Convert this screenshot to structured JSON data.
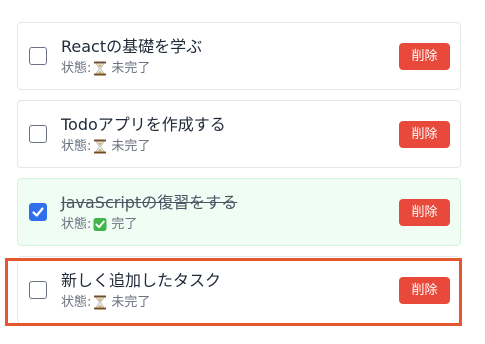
{
  "todos": [
    {
      "title": "Reactの基礎を学ぶ",
      "status_prefix": "状態:",
      "status_icon": "hourglass-icon",
      "status_text": "未完了",
      "completed": false,
      "delete_label": "削除"
    },
    {
      "title": "Todoアプリを作成する",
      "status_prefix": "状態:",
      "status_icon": "hourglass-icon",
      "status_text": "未完了",
      "completed": false,
      "delete_label": "削除"
    },
    {
      "title": "JavaScriptの復習をする",
      "status_prefix": "状態:",
      "status_icon": "green-check-icon",
      "status_text": "完了",
      "completed": true,
      "delete_label": "削除"
    },
    {
      "title": "新しく追加したタスク",
      "status_prefix": "状態:",
      "status_icon": "hourglass-icon",
      "status_text": "未完了",
      "completed": false,
      "delete_label": "削除"
    }
  ],
  "colors": {
    "delete_button": "#e8493b",
    "checkbox_checked": "#2f6fed",
    "completed_background": "#f0fdf4",
    "highlight_frame": "#e4572e"
  }
}
